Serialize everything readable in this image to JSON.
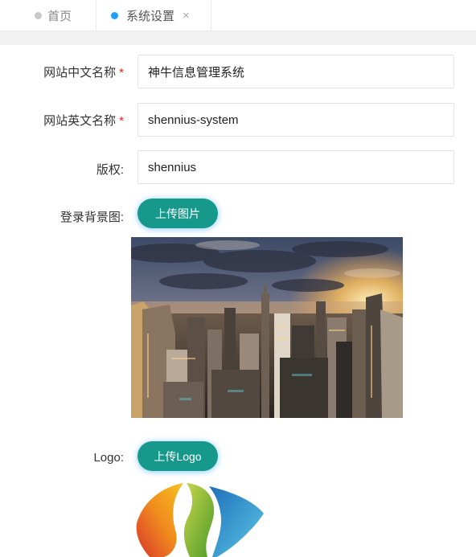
{
  "tabs": [
    {
      "label": "首页"
    },
    {
      "label": "系统设置",
      "close": "×"
    }
  ],
  "form": {
    "cn_name": {
      "label": "网站中文名称",
      "required": "*",
      "value": "神牛信息管理系统"
    },
    "en_name": {
      "label": "网站英文名称",
      "required": "*",
      "value": "shennius-system"
    },
    "copyright": {
      "label": "版权:",
      "value": "shennius"
    },
    "bg": {
      "label": "登录背景图:",
      "button": "上传图片"
    },
    "logo": {
      "label": "Logo:",
      "button": "上传Logo"
    }
  },
  "colors": {
    "accent": "#16998a",
    "active_dot": "#1e9fff",
    "required": "#e02020"
  }
}
